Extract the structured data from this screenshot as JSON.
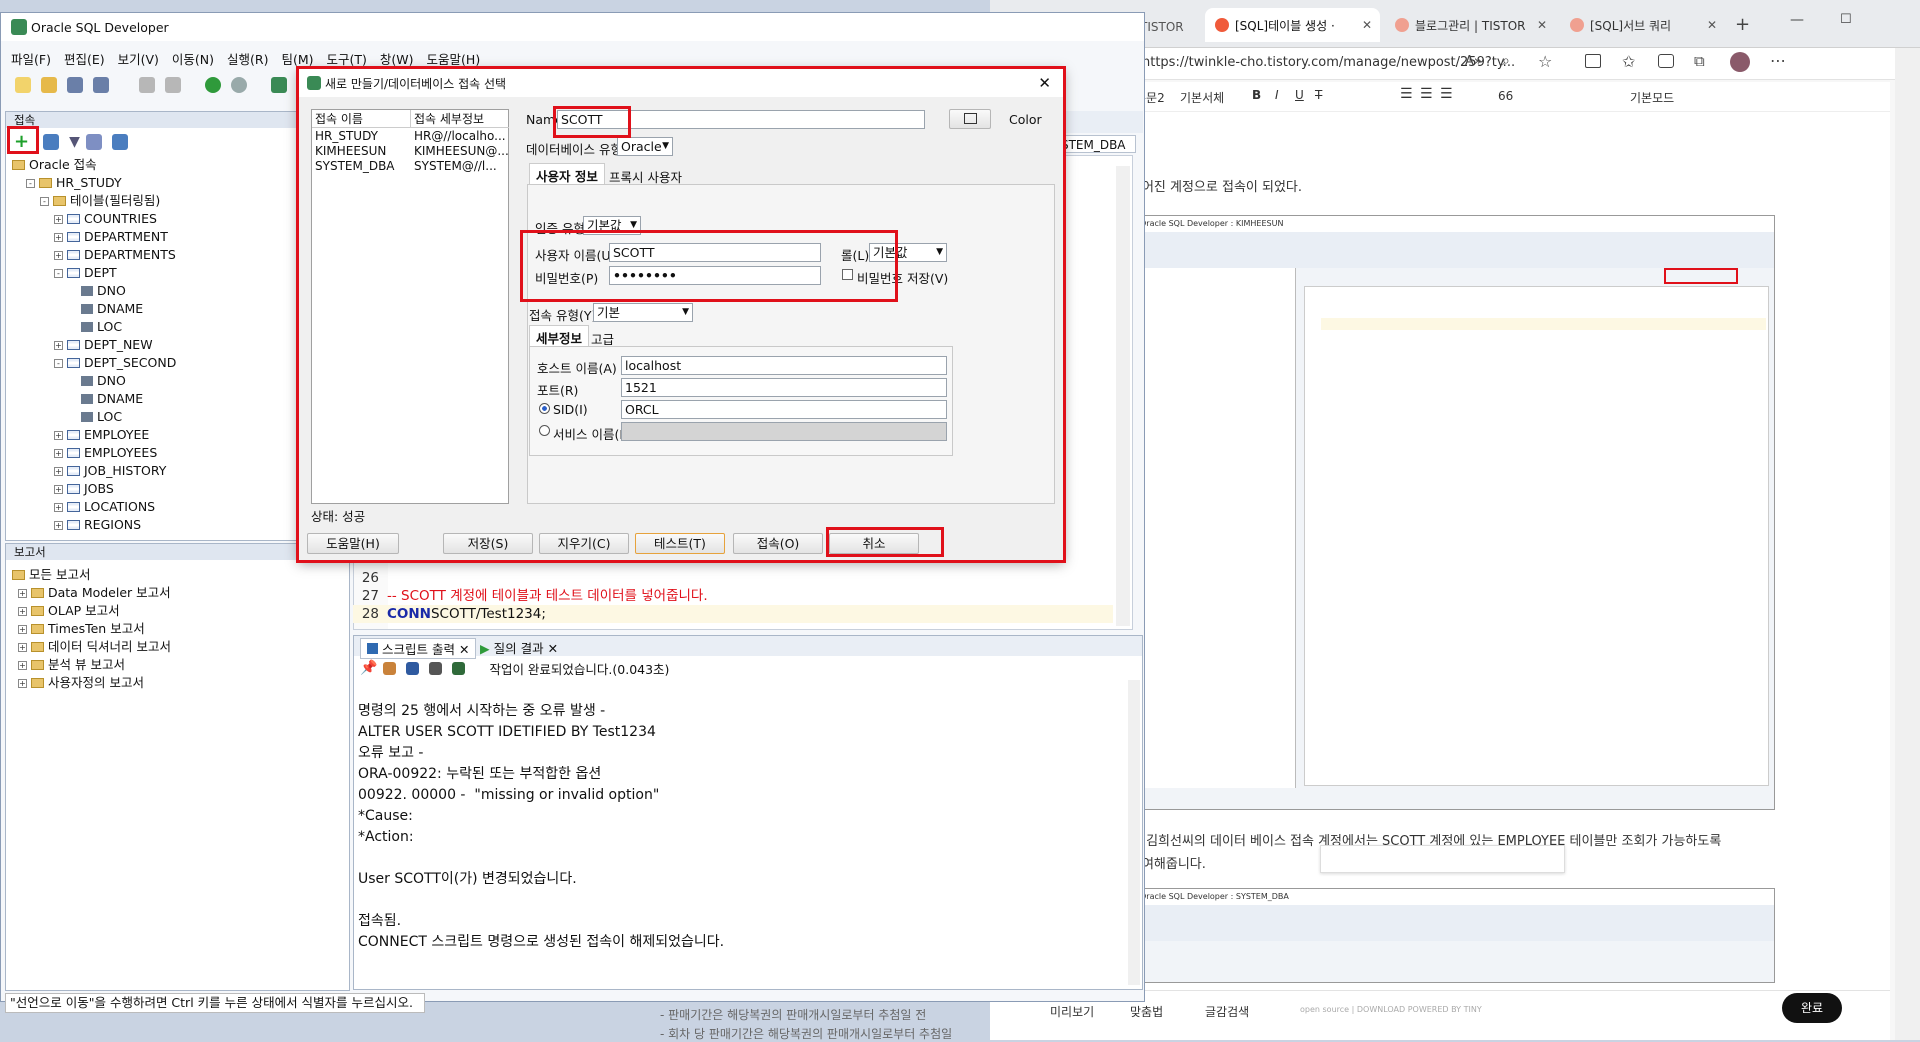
{
  "browser_tabs": [
    {
      "label": "[SQL]테이블 생성 ·"
    },
    {
      "label": "블로그관리 | TISTOR"
    },
    {
      "label": "[SQL]서브 쿼리"
    }
  ],
  "browser_tab_left_label": "TISTOR",
  "address_bar": "https://twinkle-cho.tistory.com/manage/newpost/259?ty...",
  "blog_editor": {
    "toolbar_items": [
      "본문2",
      "기본서체",
      "B",
      "I",
      "U",
      "T",
      "66",
      "기본모드"
    ],
    "text_line1": "들어진 계정으로 접속이 되었다.",
    "text_line2": "한 김희선씨의 데이터 베이스 접속 계정에서는 SCOTT 계정에 있는 EMPLOYEE 테이블만 조회가 가능하도록",
    "text_line3": "부여해줍니다.",
    "thumb1_title": "Oracle SQL Developer : KIMHEESUN",
    "thumb2_title": "Oracle SQL Developer : SYSTEM_DBA",
    "bottom_bar": [
      "미리보기",
      "맞춤법",
      "글감검색"
    ],
    "powered": "open source | DOWNLOAD POWERED BY TINY",
    "done_button": "완료",
    "list_line1": "- 판매기간은 해당복권의 판매개시일로부터 추첨일 전",
    "list_line2": "- 회차 당 판매기간은 해당복권의 판매개시일로부터 추첨일"
  },
  "sqldev": {
    "title": "Oracle SQL Developer",
    "menu": [
      "파일(F)",
      "편집(E)",
      "보기(V)",
      "이동(N)",
      "실행(R)",
      "팀(M)",
      "도구(T)",
      "창(W)",
      "도움말(H)"
    ],
    "connections_panel_title": "접속",
    "tree": [
      {
        "label": "Oracle 접속",
        "level": 0,
        "icon": "folder"
      },
      {
        "label": "HR_STUDY",
        "level": 1,
        "icon": "conn",
        "exp": "-"
      },
      {
        "label": "테이블(필터링됨)",
        "level": 2,
        "icon": "folder",
        "exp": "-"
      },
      {
        "label": "COUNTRIES",
        "level": 3,
        "icon": "table",
        "exp": "+"
      },
      {
        "label": "DEPARTMENT",
        "level": 3,
        "icon": "table",
        "exp": "+"
      },
      {
        "label": "DEPARTMENTS",
        "level": 3,
        "icon": "table",
        "exp": "+"
      },
      {
        "label": "DEPT",
        "level": 3,
        "icon": "table",
        "exp": "-"
      },
      {
        "label": "DNO",
        "level": 4,
        "icon": "col"
      },
      {
        "label": "DNAME",
        "level": 4,
        "icon": "col"
      },
      {
        "label": "LOC",
        "level": 4,
        "icon": "col"
      },
      {
        "label": "DEPT_NEW",
        "level": 3,
        "icon": "table",
        "exp": "+"
      },
      {
        "label": "DEPT_SECOND",
        "level": 3,
        "icon": "table",
        "exp": "-"
      },
      {
        "label": "DNO",
        "level": 4,
        "icon": "col"
      },
      {
        "label": "DNAME",
        "level": 4,
        "icon": "col"
      },
      {
        "label": "LOC",
        "level": 4,
        "icon": "col"
      },
      {
        "label": "EMPLOYEE",
        "level": 3,
        "icon": "table",
        "exp": "+"
      },
      {
        "label": "EMPLOYEES",
        "level": 3,
        "icon": "table",
        "exp": "+"
      },
      {
        "label": "JOB_HISTORY",
        "level": 3,
        "icon": "table",
        "exp": "+"
      },
      {
        "label": "JOBS",
        "level": 3,
        "icon": "table",
        "exp": "+"
      },
      {
        "label": "LOCATIONS",
        "level": 3,
        "icon": "table",
        "exp": "+"
      },
      {
        "label": "REGIONS",
        "level": 3,
        "icon": "table",
        "exp": "+"
      }
    ],
    "reports_panel_title": "보고서",
    "reports": [
      {
        "label": "모든 보고서",
        "level": 0
      },
      {
        "label": "Data Modeler 보고서",
        "level": 1
      },
      {
        "label": "OLAP 보고서",
        "level": 1
      },
      {
        "label": "TimesTen 보고서",
        "level": 1
      },
      {
        "label": "데이터 딕셔너리 보고서",
        "level": 1
      },
      {
        "label": "분석 뷰 보고서",
        "level": 1
      },
      {
        "label": "사용자정의 보고서",
        "level": 1
      }
    ],
    "conn_selector": "SYSTEM_DBA",
    "code_lines": [
      {
        "num": "26",
        "text": "",
        "type": "plain"
      },
      {
        "num": "27",
        "text": "-- SCOTT 계정에 테이블과 테스트 데이터를 넣어줍니다.",
        "type": "comment"
      },
      {
        "num": "28",
        "text_kw": "CONN",
        "text": " SCOTT/Test1234;",
        "type": "keyword"
      }
    ],
    "output_tabs": [
      "스크립트 출력",
      "질의 결과"
    ],
    "output_status": "작업이 완료되었습니다.(0.043초)",
    "output_lines": [
      "",
      "명령의 25 행에서 시작하는 중 오류 발생 -",
      "ALTER USER SCOTT IDETIFIED BY Test1234",
      "오류 보고 -",
      "ORA-00922: 누락된 또는 부적합한 옵션",
      "00922. 00000 -  \"missing or invalid option\"",
      "*Cause:",
      "*Action:",
      "",
      "User SCOTT이(가) 변경되었습니다.",
      "",
      "접속됨.",
      "CONNECT 스크립트 명령으로 생성된 접속이 해제되었습니다."
    ],
    "status_bar": "\"선언으로 이동\"을 수행하려면 Ctrl 키를 누른 상태에서 식별자를 누르십시오."
  },
  "dialog": {
    "title": "새로 만들기/데이터베이스 접속 선택",
    "list_headers": [
      "접속 이름",
      "접속 세부정보"
    ],
    "connections": [
      {
        "name": "HR_STUDY",
        "detail": "HR@//localho..."
      },
      {
        "name": "KIMHEESUN",
        "detail": "KIMHEESUN@..."
      },
      {
        "name": "SYSTEM_DBA",
        "detail": "SYSTEM@//l..."
      }
    ],
    "name_label": "Name",
    "name_value": "SCOTT",
    "color_label": "Color",
    "db_type_label": "데이터베이스 유형",
    "db_type_value": "Oracle",
    "tabs": [
      "사용자 정보",
      "프록시 사용자"
    ],
    "auth_type_label": "인증 유형",
    "auth_type_value": "기본값",
    "username_label": "사용자 이름(U)",
    "username_value": "SCOTT",
    "password_label": "비밀번호(P)",
    "password_value": "••••••••",
    "role_label": "롤(L)",
    "role_value": "기본값",
    "save_password_label": "비밀번호 저장(V)",
    "conn_type_label": "접속 유형(Y)",
    "conn_type_value": "기본",
    "detail_tabs": [
      "세부정보",
      "고급"
    ],
    "host_label": "호스트 이름(A)",
    "host_value": "localhost",
    "port_label": "포트(R)",
    "port_value": "1521",
    "sid_label": "SID(I)",
    "sid_value": "ORCL",
    "service_label": "서비스 이름(E)",
    "status": "상태: 성공",
    "buttons": {
      "help": "도움말(H)",
      "save": "저장(S)",
      "clear": "지우기(C)",
      "test": "테스트(T)",
      "connect": "접속(O)",
      "cancel": "취소"
    }
  }
}
